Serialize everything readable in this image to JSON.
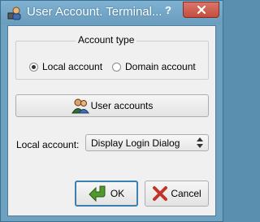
{
  "window": {
    "title": "User Account. Terminal...",
    "help_label": "?",
    "icons": {
      "app": "user-terminal-icon",
      "close": "close-icon"
    }
  },
  "account_type": {
    "legend": "Account type",
    "options": [
      {
        "label": "Local account",
        "selected": true
      },
      {
        "label": "Domain account",
        "selected": false
      }
    ]
  },
  "user_accounts_button": {
    "label": "User accounts",
    "icon": "users-icon"
  },
  "local_account": {
    "label": "Local account:",
    "selected_value": "Display Login Dialog"
  },
  "buttons": {
    "ok_label": "OK",
    "ok_icon": "green-arrow-icon",
    "cancel_label": "Cancel",
    "cancel_icon": "red-x-icon"
  },
  "colors": {
    "title_bar": "#6ea0bf",
    "close_button": "#c44e3f",
    "ok_icon": "#4f9a2a",
    "cancel_icon": "#c0352b"
  }
}
